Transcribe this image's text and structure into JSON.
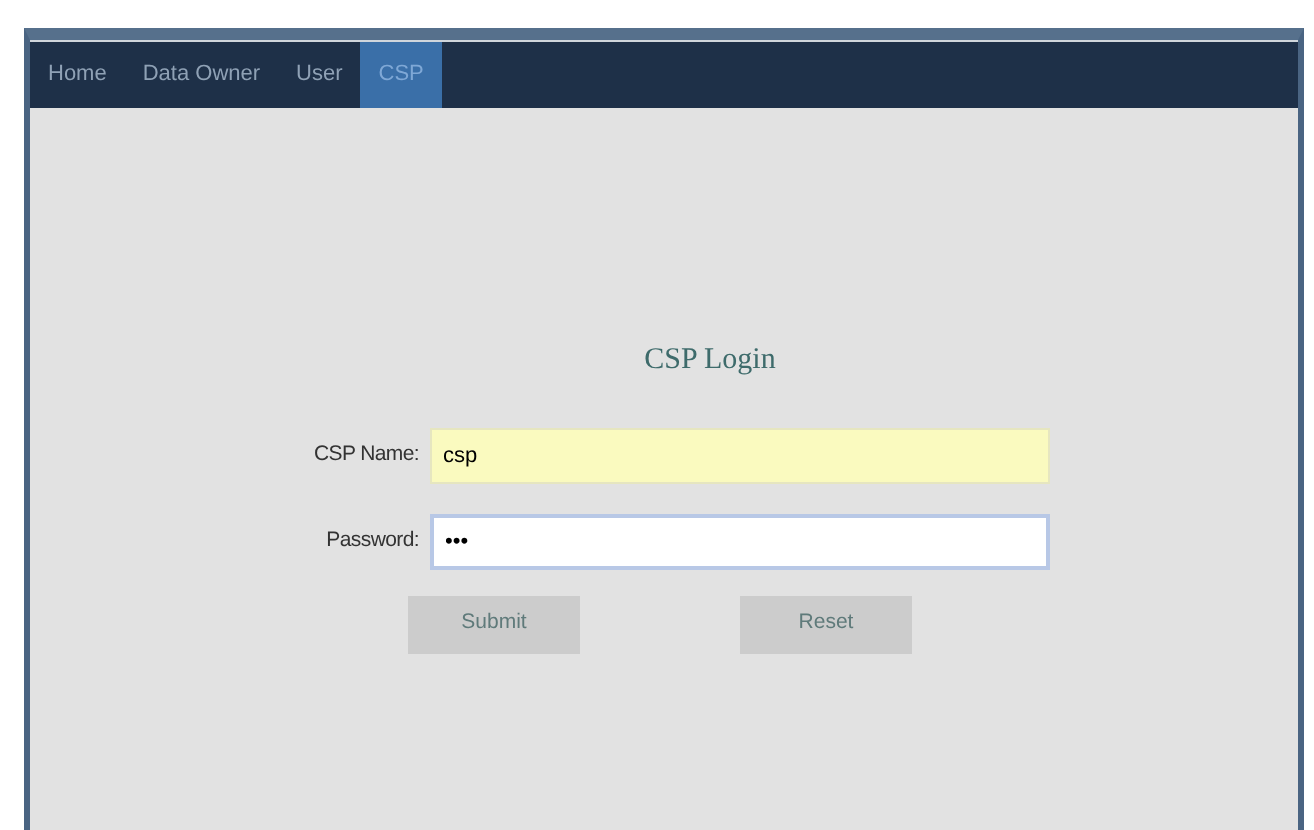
{
  "nav": [
    {
      "label": "Home",
      "selected": false
    },
    {
      "label": "Data Owner",
      "selected": false
    },
    {
      "label": "User",
      "selected": false
    },
    {
      "label": "CSP",
      "selected": true
    }
  ],
  "form": {
    "title": "CSP Login",
    "fields": [
      {
        "label": "CSP Name:",
        "value": "csp",
        "autofilled": true
      },
      {
        "label": "Password:",
        "value": "•••",
        "autofilled": false
      }
    ],
    "buttons": [
      "Submit",
      "Reset"
    ]
  }
}
